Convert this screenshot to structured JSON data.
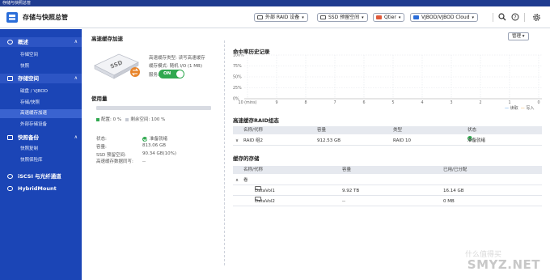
{
  "window": {
    "title": "存储与快照总管"
  },
  "app": {
    "title": "存储与快照总管"
  },
  "toolbar": {
    "raid_devices": "外部 RAID 设备",
    "ssd_profiling": "SSD 预留空间",
    "qtier": "Qtier",
    "vjbod": "VJBOD/VJBOD Cloud"
  },
  "sidebar": {
    "sections": [
      {
        "label": "概述",
        "items": [
          {
            "label": "存储空间"
          },
          {
            "label": "快照"
          }
        ]
      },
      {
        "label": "存储空间",
        "items": [
          {
            "label": "磁盘 / VJBOD"
          },
          {
            "label": "存储/快照"
          },
          {
            "label": "高速缓存加速"
          },
          {
            "label": "外部存储设备"
          }
        ]
      },
      {
        "label": "快照备份",
        "items": [
          {
            "label": "快照复制"
          },
          {
            "label": "快照保险库"
          }
        ]
      },
      {
        "label": "iSCSI 与光纤通道",
        "items": []
      },
      {
        "label": "HybridMount",
        "items": []
      }
    ]
  },
  "main": {
    "title": "高速缓存加速",
    "manage_label": "管理",
    "ssd_label": "SSD",
    "cache_type_label": "高速缓存类型: 读写高速缓存",
    "cache_mode_label": "缓存模式: 随机 I/O (1 MB)",
    "service_label": "服务:",
    "service_toggle": "ON",
    "usage_title": "使用量",
    "usage_percent": 0,
    "usage_legend_used": "配置: 0 %",
    "usage_legend_free": "剩余空间: 100 %",
    "status_label": "状态:",
    "status_value": "准备就绪",
    "capacity_label": "容量:",
    "capacity_value": "813.06 GB",
    "ssd_reserved_label": "SSD 预留空间:",
    "ssd_reserved_value": "90.34 GB(10%)",
    "bypass_label": "高速缓存数据同写:",
    "bypass_value": "--"
  },
  "hit_chart": {
    "title": "命中率历史记录",
    "legend_read": "读取",
    "legend_write": "写入",
    "colors": {
      "read": "#3a8ee6",
      "write": "#f2a33a"
    }
  },
  "chart_data": {
    "type": "line",
    "title": "命中率历史记录",
    "x": [
      "10 (mins)",
      "9",
      "8",
      "7",
      "6",
      "5",
      "4",
      "3",
      "2",
      "1",
      "0"
    ],
    "ylim": [
      0,
      100
    ],
    "yticks": [
      "100%",
      "75%",
      "50%",
      "25%",
      "0%"
    ],
    "series": [
      {
        "name": "读取",
        "values": []
      },
      {
        "name": "写入",
        "values": []
      }
    ],
    "legend_position": "bottom-right",
    "grid": true
  },
  "raid_table": {
    "title": "高速缓存RAID组态",
    "headers": [
      "名称/代称",
      "容量",
      "类型",
      "状态"
    ],
    "rows": [
      {
        "name": "RAID 组2",
        "capacity": "912.53 GB",
        "type": "RAID 10",
        "status": "准备就绪"
      }
    ]
  },
  "cached_table": {
    "title": "缓存的存储",
    "headers": [
      "名称/代称",
      "容量",
      "已用/已分配"
    ],
    "group": "卷",
    "rows": [
      {
        "name": "DataVol1",
        "capacity": "9.92 TB",
        "used": "16.14 GB"
      },
      {
        "name": "DataVol2",
        "capacity": "--",
        "used": "0 MB"
      }
    ]
  },
  "watermark": {
    "text": "SMYZ.NET",
    "sub": "什么值得买"
  }
}
